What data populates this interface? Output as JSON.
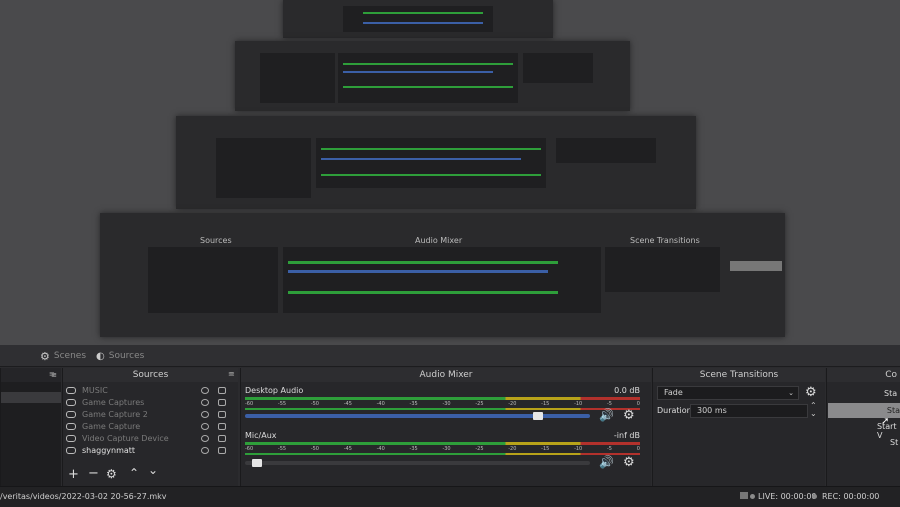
{
  "tabs": {
    "scenes": "Scenes",
    "sources": "Sources"
  },
  "docks": {
    "sources_title": "Sources",
    "mixer_title": "Audio Mixer",
    "transitions_title": "Scene Transitions",
    "controls_title": "Co"
  },
  "sources": [
    {
      "name": "MUSIC",
      "active": false
    },
    {
      "name": "Game Captures",
      "active": false
    },
    {
      "name": "Game Capture 2",
      "active": false
    },
    {
      "name": "Game Capture",
      "active": false
    },
    {
      "name": "Video Capture Device",
      "active": false
    },
    {
      "name": "shaggynmatt",
      "active": true
    }
  ],
  "mixer": {
    "desktop": {
      "label": "Desktop Audio",
      "db": "0.0 dB",
      "level": 0.85
    },
    "mic": {
      "label": "Mic/Aux",
      "db": "-inf dB",
      "level": 0.02
    },
    "ticks": [
      "-60",
      "-55",
      "-50",
      "-45",
      "-40",
      "-35",
      "-30",
      "-25",
      "-20",
      "-15",
      "-10",
      "-5",
      "0"
    ]
  },
  "transitions": {
    "type": "Fade",
    "duration_label": "Duration",
    "duration_value": "300 ms"
  },
  "controls": {
    "item1": "Sta",
    "item2": "Sta",
    "item3": "Start V",
    "item4": "St"
  },
  "status": {
    "path": "/veritas/videos/2022-03-02 20-56-27.mkv",
    "live": "LIVE: 00:00:00",
    "rec": "REC: 00:00:00"
  },
  "colors": {
    "meter_green": "#2e9e3a",
    "meter_yellow": "#b8a31a",
    "meter_red": "#b2312c",
    "fader_blue": "#3b5fa6"
  }
}
